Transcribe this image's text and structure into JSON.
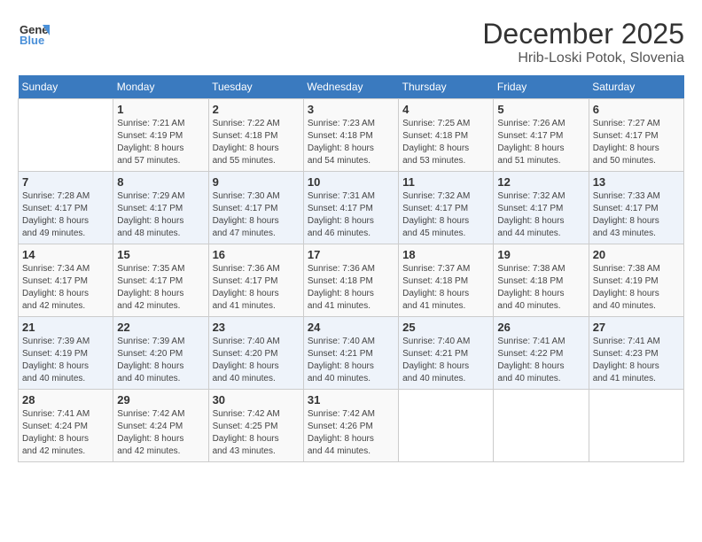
{
  "header": {
    "logo_general": "General",
    "logo_blue": "Blue",
    "month_title": "December 2025",
    "location": "Hrib-Loski Potok, Slovenia"
  },
  "weekdays": [
    "Sunday",
    "Monday",
    "Tuesday",
    "Wednesday",
    "Thursday",
    "Friday",
    "Saturday"
  ],
  "weeks": [
    [
      {
        "day": "",
        "info": ""
      },
      {
        "day": "1",
        "info": "Sunrise: 7:21 AM\nSunset: 4:19 PM\nDaylight: 8 hours\nand 57 minutes."
      },
      {
        "day": "2",
        "info": "Sunrise: 7:22 AM\nSunset: 4:18 PM\nDaylight: 8 hours\nand 55 minutes."
      },
      {
        "day": "3",
        "info": "Sunrise: 7:23 AM\nSunset: 4:18 PM\nDaylight: 8 hours\nand 54 minutes."
      },
      {
        "day": "4",
        "info": "Sunrise: 7:25 AM\nSunset: 4:18 PM\nDaylight: 8 hours\nand 53 minutes."
      },
      {
        "day": "5",
        "info": "Sunrise: 7:26 AM\nSunset: 4:17 PM\nDaylight: 8 hours\nand 51 minutes."
      },
      {
        "day": "6",
        "info": "Sunrise: 7:27 AM\nSunset: 4:17 PM\nDaylight: 8 hours\nand 50 minutes."
      }
    ],
    [
      {
        "day": "7",
        "info": "Sunrise: 7:28 AM\nSunset: 4:17 PM\nDaylight: 8 hours\nand 49 minutes."
      },
      {
        "day": "8",
        "info": "Sunrise: 7:29 AM\nSunset: 4:17 PM\nDaylight: 8 hours\nand 48 minutes."
      },
      {
        "day": "9",
        "info": "Sunrise: 7:30 AM\nSunset: 4:17 PM\nDaylight: 8 hours\nand 47 minutes."
      },
      {
        "day": "10",
        "info": "Sunrise: 7:31 AM\nSunset: 4:17 PM\nDaylight: 8 hours\nand 46 minutes."
      },
      {
        "day": "11",
        "info": "Sunrise: 7:32 AM\nSunset: 4:17 PM\nDaylight: 8 hours\nand 45 minutes."
      },
      {
        "day": "12",
        "info": "Sunrise: 7:32 AM\nSunset: 4:17 PM\nDaylight: 8 hours\nand 44 minutes."
      },
      {
        "day": "13",
        "info": "Sunrise: 7:33 AM\nSunset: 4:17 PM\nDaylight: 8 hours\nand 43 minutes."
      }
    ],
    [
      {
        "day": "14",
        "info": "Sunrise: 7:34 AM\nSunset: 4:17 PM\nDaylight: 8 hours\nand 42 minutes."
      },
      {
        "day": "15",
        "info": "Sunrise: 7:35 AM\nSunset: 4:17 PM\nDaylight: 8 hours\nand 42 minutes."
      },
      {
        "day": "16",
        "info": "Sunrise: 7:36 AM\nSunset: 4:17 PM\nDaylight: 8 hours\nand 41 minutes."
      },
      {
        "day": "17",
        "info": "Sunrise: 7:36 AM\nSunset: 4:18 PM\nDaylight: 8 hours\nand 41 minutes."
      },
      {
        "day": "18",
        "info": "Sunrise: 7:37 AM\nSunset: 4:18 PM\nDaylight: 8 hours\nand 41 minutes."
      },
      {
        "day": "19",
        "info": "Sunrise: 7:38 AM\nSunset: 4:18 PM\nDaylight: 8 hours\nand 40 minutes."
      },
      {
        "day": "20",
        "info": "Sunrise: 7:38 AM\nSunset: 4:19 PM\nDaylight: 8 hours\nand 40 minutes."
      }
    ],
    [
      {
        "day": "21",
        "info": "Sunrise: 7:39 AM\nSunset: 4:19 PM\nDaylight: 8 hours\nand 40 minutes."
      },
      {
        "day": "22",
        "info": "Sunrise: 7:39 AM\nSunset: 4:20 PM\nDaylight: 8 hours\nand 40 minutes."
      },
      {
        "day": "23",
        "info": "Sunrise: 7:40 AM\nSunset: 4:20 PM\nDaylight: 8 hours\nand 40 minutes."
      },
      {
        "day": "24",
        "info": "Sunrise: 7:40 AM\nSunset: 4:21 PM\nDaylight: 8 hours\nand 40 minutes."
      },
      {
        "day": "25",
        "info": "Sunrise: 7:40 AM\nSunset: 4:21 PM\nDaylight: 8 hours\nand 40 minutes."
      },
      {
        "day": "26",
        "info": "Sunrise: 7:41 AM\nSunset: 4:22 PM\nDaylight: 8 hours\nand 40 minutes."
      },
      {
        "day": "27",
        "info": "Sunrise: 7:41 AM\nSunset: 4:23 PM\nDaylight: 8 hours\nand 41 minutes."
      }
    ],
    [
      {
        "day": "28",
        "info": "Sunrise: 7:41 AM\nSunset: 4:24 PM\nDaylight: 8 hours\nand 42 minutes."
      },
      {
        "day": "29",
        "info": "Sunrise: 7:42 AM\nSunset: 4:24 PM\nDaylight: 8 hours\nand 42 minutes."
      },
      {
        "day": "30",
        "info": "Sunrise: 7:42 AM\nSunset: 4:25 PM\nDaylight: 8 hours\nand 43 minutes."
      },
      {
        "day": "31",
        "info": "Sunrise: 7:42 AM\nSunset: 4:26 PM\nDaylight: 8 hours\nand 44 minutes."
      },
      {
        "day": "",
        "info": ""
      },
      {
        "day": "",
        "info": ""
      },
      {
        "day": "",
        "info": ""
      }
    ]
  ]
}
